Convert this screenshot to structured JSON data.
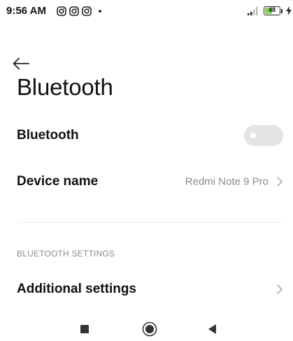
{
  "status_bar": {
    "time": "9:56 AM",
    "battery_level": "48",
    "battery_fraction": 0.48,
    "battery_color": "#7ed957",
    "notification_icons": [
      "instagram-icon",
      "instagram-icon",
      "instagram-icon"
    ],
    "right_icons": [
      "signal-icon",
      "battery-icon",
      "charging-icon"
    ]
  },
  "header": {
    "back_icon": "back-arrow-icon",
    "title": "Bluetooth"
  },
  "rows": {
    "bluetooth": {
      "label": "Bluetooth",
      "toggle_on": false
    },
    "device_name": {
      "label": "Device name",
      "value": "Redmi Note 9 Pro",
      "icon": "chevron-right-icon"
    },
    "additional_settings": {
      "label": "Additional settings",
      "icon": "chevron-right-icon"
    }
  },
  "sections": {
    "bluetooth_settings": "BLUETOOTH SETTINGS"
  },
  "nav_bar": {
    "buttons": [
      "recents-square-icon",
      "home-circle-icon",
      "back-triangle-icon"
    ]
  }
}
